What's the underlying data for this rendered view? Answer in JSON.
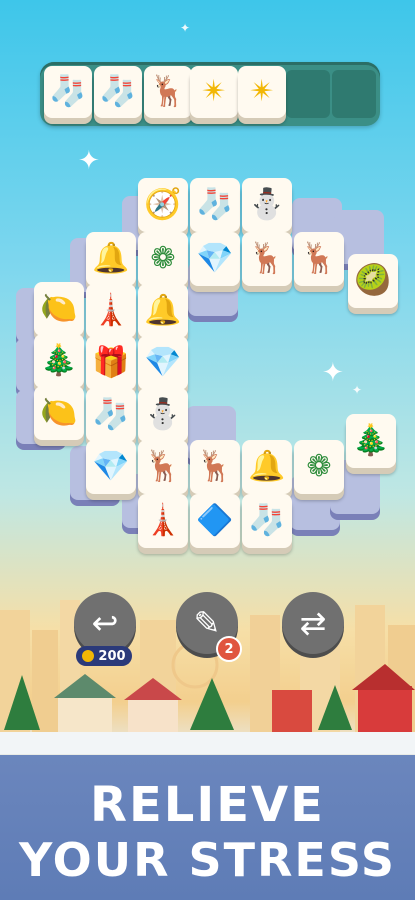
{
  "tray": {
    "tiles": [
      {
        "icon": "stocking-icon",
        "glyph": "🧦"
      },
      {
        "icon": "stocking-icon",
        "glyph": "🧦"
      },
      {
        "icon": "reindeer-icon",
        "glyph": "🦌"
      },
      {
        "icon": "star-icon",
        "glyph": "✴"
      },
      {
        "icon": "star-icon",
        "glyph": "✴"
      }
    ],
    "slots_total": 7
  },
  "board": {
    "tiles": [
      {
        "icon": "compass-icon",
        "glyph": "🧭"
      },
      {
        "icon": "stocking-icon",
        "glyph": "🧦"
      },
      {
        "icon": "snowman-icon",
        "glyph": "⛄"
      },
      {
        "icon": "bell-icon",
        "glyph": "🔔"
      },
      {
        "icon": "wreath-icon",
        "glyph": "❁"
      },
      {
        "icon": "gem-icon",
        "glyph": "💎"
      },
      {
        "icon": "reindeer-icon",
        "glyph": "🦌"
      },
      {
        "icon": "reindeer-icon",
        "glyph": "🦌"
      },
      {
        "icon": "kiwi-icon",
        "glyph": "🥝"
      },
      {
        "icon": "lemon-icon",
        "glyph": "🍋"
      },
      {
        "icon": "lighthouse-icon",
        "glyph": "🗼"
      },
      {
        "icon": "holly-bell-icon",
        "glyph": "🔔"
      },
      {
        "icon": "tree-icon",
        "glyph": "🎄"
      },
      {
        "icon": "gift-icon",
        "glyph": "🎁"
      },
      {
        "icon": "gem-icon",
        "glyph": "💎"
      },
      {
        "icon": "lemon-icon",
        "glyph": "🍋"
      },
      {
        "icon": "stocking-icon",
        "glyph": "🧦"
      },
      {
        "icon": "snowman-icon",
        "glyph": "⛄"
      },
      {
        "icon": "tree-icon",
        "glyph": "🎄"
      },
      {
        "icon": "gem-icon",
        "glyph": "💎"
      },
      {
        "icon": "reindeer-icon",
        "glyph": "🦌"
      },
      {
        "icon": "reindeer-icon",
        "glyph": "🦌"
      },
      {
        "icon": "bell-icon",
        "glyph": "🔔"
      },
      {
        "icon": "wreath-icon",
        "glyph": "❁"
      },
      {
        "icon": "lighthouse-icon",
        "glyph": "🗼"
      },
      {
        "icon": "blue-gem-icon",
        "glyph": "🔷"
      },
      {
        "icon": "stocking-icon",
        "glyph": "🧦"
      }
    ]
  },
  "controls": {
    "undo": {
      "icon": "undo-icon",
      "cost": "200"
    },
    "magic_wand": {
      "icon": "magic-wand-icon",
      "count": "2"
    },
    "shuffle": {
      "icon": "shuffle-icon"
    }
  },
  "banner": {
    "line1": "RELIEVE",
    "line2": "YOUR STRESS"
  },
  "colors": {
    "tray": "#3b8f86",
    "banner": "#6b86bd",
    "control": "#707070",
    "badge": "#e0553f",
    "coin_pill": "#2b3a7a"
  }
}
